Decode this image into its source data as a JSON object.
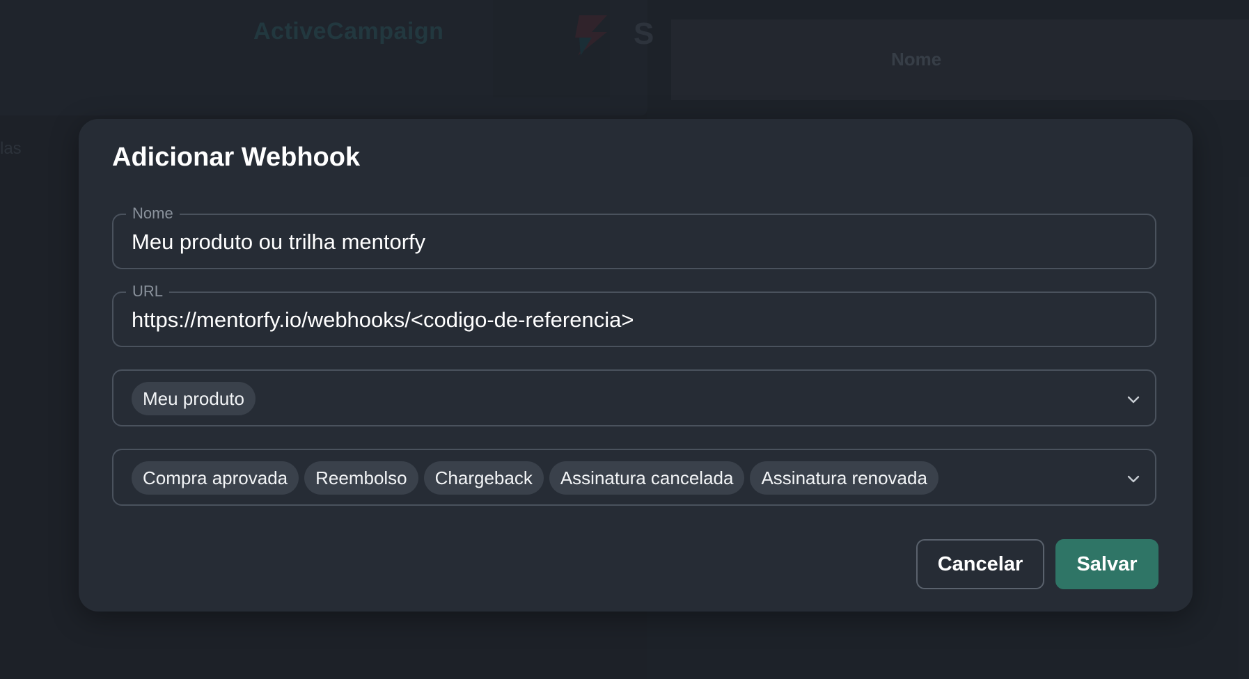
{
  "background": {
    "side_text": "las",
    "table_header": "Nome"
  },
  "modal": {
    "title": "Adicionar Webhook",
    "name_field": {
      "label": "Nome",
      "value": "Meu produto ou trilha mentorfy"
    },
    "url_field": {
      "label": "URL",
      "value": "https://mentorfy.io/webhooks/<codigo-de-referencia>"
    },
    "product_select": {
      "selected": [
        "Meu produto"
      ],
      "icon": "chevron-down-icon"
    },
    "events_select": {
      "selected": [
        "Compra aprovada",
        "Reembolso",
        "Chargeback",
        "Assinatura cancelada",
        "Assinatura renovada"
      ],
      "icon": "chevron-down-icon"
    },
    "cancel_label": "Cancelar",
    "save_label": "Salvar"
  },
  "colors": {
    "accent": "#2f7566",
    "modal_bg": "#262c35",
    "border": "#4a525d",
    "chip_bg": "#3a414b"
  }
}
